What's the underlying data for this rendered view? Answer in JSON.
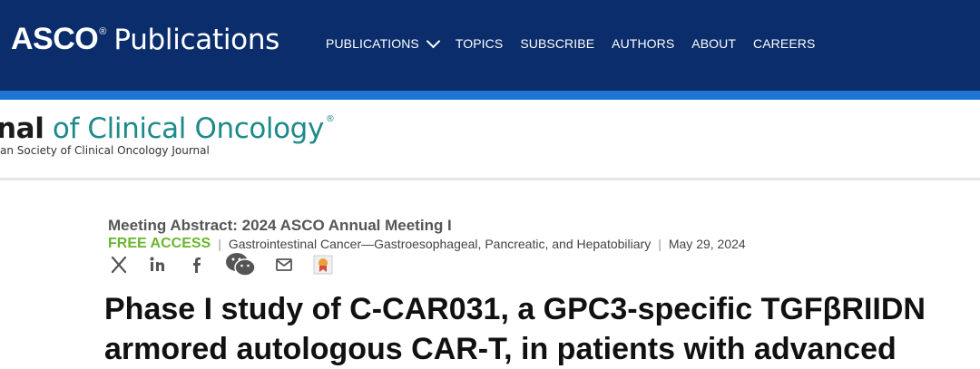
{
  "header": {
    "brand_asco": "ASCO",
    "brand_reg": "®",
    "brand_publications": "Publications",
    "nav": [
      {
        "label": "PUBLICATIONS",
        "has_dropdown": true
      },
      {
        "label": "TOPICS"
      },
      {
        "label": "SUBSCRIBE"
      },
      {
        "label": "AUTHORS"
      },
      {
        "label": "ABOUT"
      },
      {
        "label": "CAREERS"
      }
    ],
    "bar_color": "#0b2d6b",
    "accent_color": "#1f76d2"
  },
  "journal": {
    "title_bold": "nal",
    "title_rest": " of Clinical Oncology",
    "reg": "®",
    "subtitle": "an Society of Clinical Oncology Journal",
    "title_color": "#1d8a8a"
  },
  "article": {
    "meeting": "Meeting Abstract: 2024 ASCO Annual Meeting I",
    "access": "FREE ACCESS",
    "access_color": "#6bb52e",
    "separator": "|",
    "category": "Gastrointestinal Cancer—Gastroesophageal, Pancreatic, and Hepatobiliary",
    "date": "May 29, 2024",
    "title_line1": "Phase I study of C-CAR031, a GPC3-specific TGFβRIIDN",
    "title_line2": "armored autologous CAR-T, in patients with advanced"
  },
  "share_icons": [
    "x-icon",
    "linkedin-icon",
    "facebook-icon",
    "wechat-icon",
    "email-icon",
    "bookmark-icon"
  ]
}
